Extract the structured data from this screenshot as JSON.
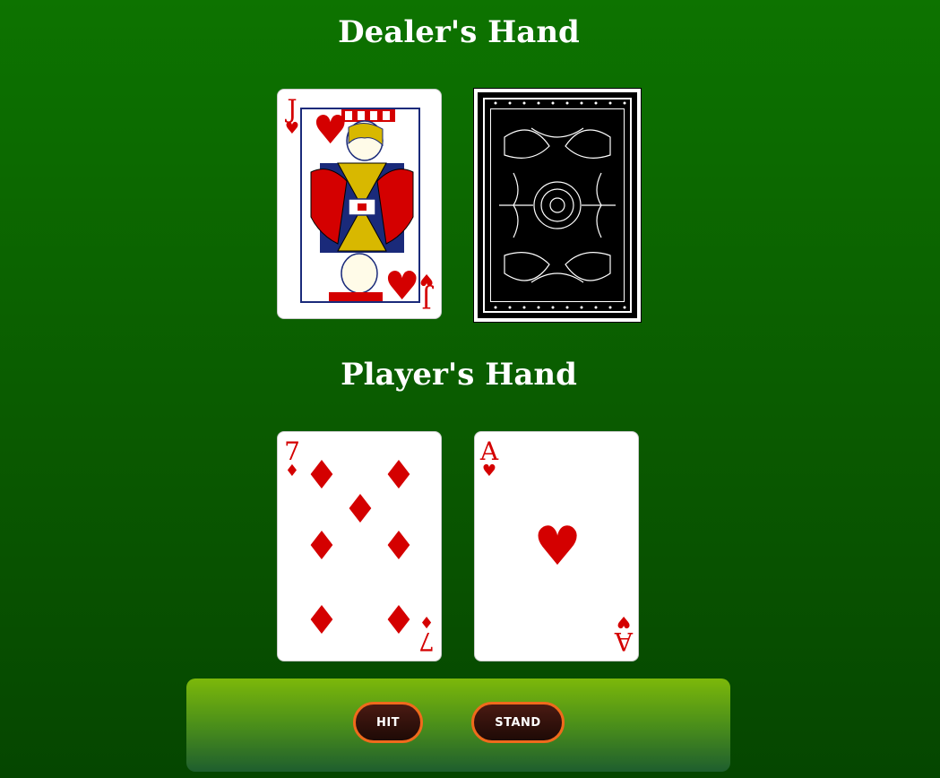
{
  "dealer": {
    "title": "Dealer's Hand",
    "cards": [
      {
        "rank": "J",
        "suit": "hearts",
        "suit_symbol": "♥",
        "face_up": true
      },
      {
        "face_up": false
      }
    ]
  },
  "player": {
    "title": "Player's Hand",
    "cards": [
      {
        "rank": "7",
        "suit": "diamonds",
        "suit_symbol": "♦",
        "face_up": true
      },
      {
        "rank": "A",
        "suit": "hearts",
        "suit_symbol": "♥",
        "face_up": true
      }
    ]
  },
  "controls": {
    "hit_label": "HIT",
    "stand_label": "STAND"
  },
  "colors": {
    "table_green": "#0d7300",
    "suit_red": "#d40000",
    "button_border": "#f06a1c"
  }
}
